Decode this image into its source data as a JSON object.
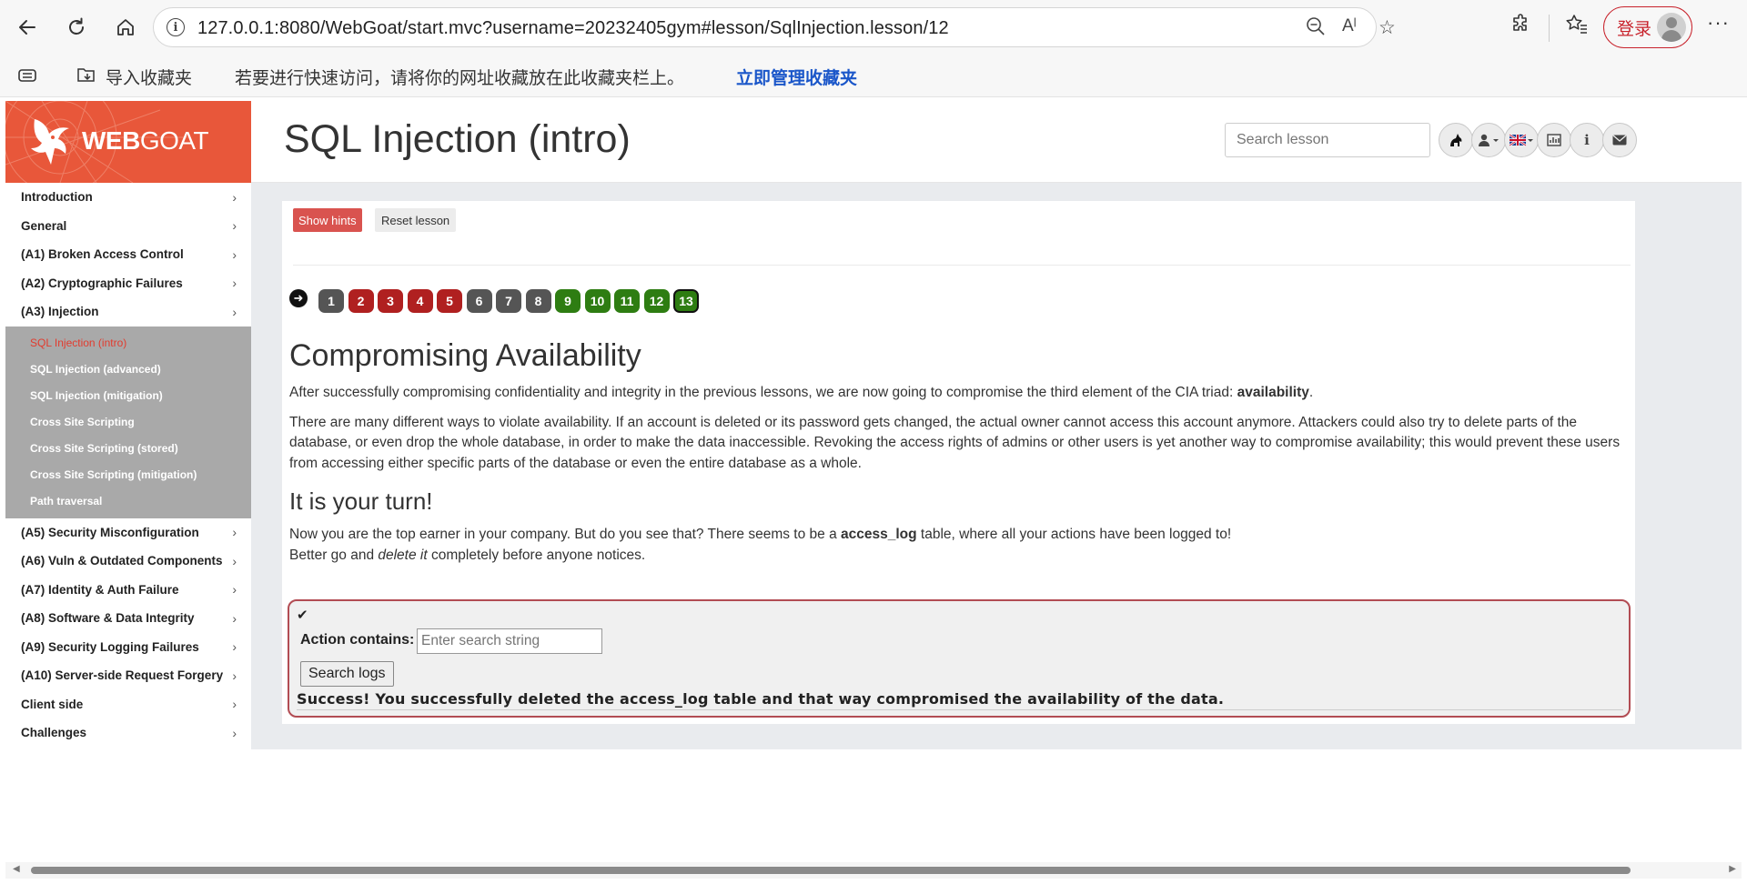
{
  "browser": {
    "url": "127.0.0.1:8080/WebGoat/start.mvc?username=20232405gym#lesson/SqlInjection.lesson/12",
    "login_label": "登录"
  },
  "favbar": {
    "import_label": "导入收藏夹",
    "hint_text": "若要进行快速访问，请将你的网址收藏放在此收藏夹栏上。",
    "manage_link": "立即管理收藏夹"
  },
  "app": {
    "logo_bold": "WEB",
    "logo_rest": "GOAT",
    "page_title": "SQL Injection (intro)",
    "search_placeholder": "Search lesson"
  },
  "sidebar": {
    "items_top": [
      {
        "label": "Introduction"
      },
      {
        "label": "General"
      },
      {
        "label": "(A1) Broken Access Control"
      },
      {
        "label": "(A2) Cryptographic Failures"
      },
      {
        "label": "(A3) Injection"
      }
    ],
    "sub_items": [
      {
        "label": "SQL Injection (intro)",
        "active": true
      },
      {
        "label": "SQL Injection (advanced)"
      },
      {
        "label": "SQL Injection (mitigation)"
      },
      {
        "label": "Cross Site Scripting"
      },
      {
        "label": "Cross Site Scripting (stored)"
      },
      {
        "label": "Cross Site Scripting (mitigation)"
      },
      {
        "label": "Path traversal"
      }
    ],
    "items_bottom": [
      {
        "label": "(A5) Security Misconfiguration"
      },
      {
        "label": "(A6) Vuln & Outdated Components"
      },
      {
        "label": "(A7) Identity & Auth Failure"
      },
      {
        "label": "(A8) Software & Data Integrity"
      },
      {
        "label": "(A9) Security Logging Failures"
      },
      {
        "label": "(A10) Server-side Request Forgery"
      },
      {
        "label": "Client side"
      },
      {
        "label": "Challenges"
      }
    ]
  },
  "lesson": {
    "show_hints": "Show hints",
    "reset_lesson": "Reset lesson",
    "pages": [
      {
        "n": "1",
        "status": "gray"
      },
      {
        "n": "2",
        "status": "red"
      },
      {
        "n": "3",
        "status": "red"
      },
      {
        "n": "4",
        "status": "red"
      },
      {
        "n": "5",
        "status": "red"
      },
      {
        "n": "6",
        "status": "gray"
      },
      {
        "n": "7",
        "status": "gray"
      },
      {
        "n": "8",
        "status": "gray"
      },
      {
        "n": "9",
        "status": "green"
      },
      {
        "n": "10",
        "status": "green"
      },
      {
        "n": "11",
        "status": "green"
      },
      {
        "n": "12",
        "status": "green"
      },
      {
        "n": "13",
        "status": "current"
      }
    ],
    "heading": "Compromising Availability",
    "p1_pre": "After successfully compromising confidentiality and integrity in the previous lessons, we are now going to compromise the third element of the CIA triad: ",
    "p1_bold": "availability",
    "p1_post": ".",
    "p2": "There are many different ways to violate availability. If an account is deleted or its password gets changed, the actual owner cannot access this account anymore. Attackers could also try to delete parts of the database, or even drop the whole database, in order to make the data inaccessible. Revoking the access rights of admins or other users is yet another way to compromise availability; this would prevent these users from accessing either specific parts of the database or even the entire database as a whole.",
    "subheading": "It is your turn!",
    "p3_pre": "Now you are the top earner in your company. But do you see that? There seems to be a ",
    "p3_bold": "access_log",
    "p3_post": " table, where all your actions have been logged to!",
    "p4_pre": "Better go and ",
    "p4_em": "delete it",
    "p4_post": " completely before anyone notices.",
    "form": {
      "label": "Action contains:",
      "placeholder": "Enter search string",
      "button": "Search logs",
      "feedback": "Success! You successfully deleted the access_log table and that way compromised the availability of the data."
    }
  }
}
